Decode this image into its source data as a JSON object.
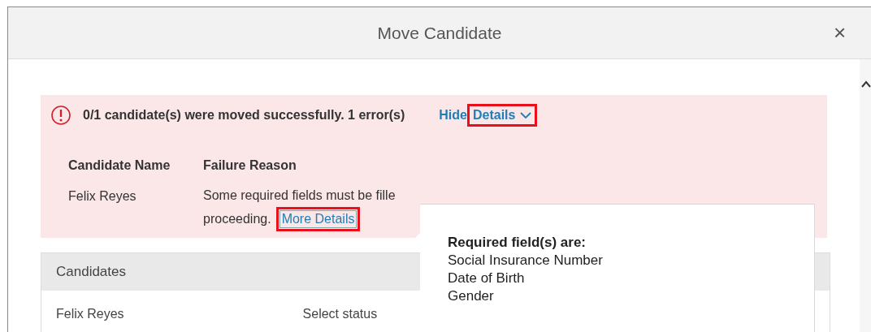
{
  "window": {
    "title": "Move Candidate",
    "close": "×"
  },
  "alert": {
    "message": "0/1 candidate(s) were moved successfully. 1 error(s)",
    "toggle": {
      "hide_text": "Hide",
      "details_text": "Details",
      "expanded": true,
      "highlighted": true
    },
    "columns": [
      "Candidate Name",
      "Failure Reason"
    ],
    "rows": [
      {
        "name": "Felix Reyes",
        "reason": "Some required fields must be fille",
        "reason_end": "proceeding.",
        "link": {
          "label": "More Details",
          "highlighted": true
        }
      }
    ]
  },
  "popover": {
    "title": "Required field(s) are:",
    "items": [
      "Social Insurance Number",
      "Date of Birth",
      "Gender"
    ]
  },
  "candidates": {
    "title": "Candidates",
    "rows": [
      {
        "name": "Felix Reyes",
        "status": "Select status"
      }
    ]
  }
}
